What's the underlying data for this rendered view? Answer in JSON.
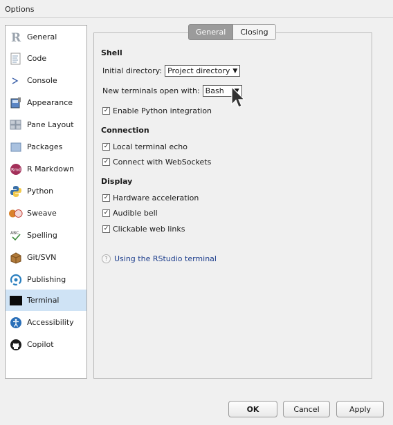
{
  "window": {
    "title": "Options"
  },
  "sidebar": {
    "items": [
      {
        "label": "General",
        "icon": "r-logo-icon"
      },
      {
        "label": "Code",
        "icon": "code-icon"
      },
      {
        "label": "Console",
        "icon": "console-icon"
      },
      {
        "label": "Appearance",
        "icon": "appearance-icon"
      },
      {
        "label": "Pane Layout",
        "icon": "pane-layout-icon"
      },
      {
        "label": "Packages",
        "icon": "packages-icon"
      },
      {
        "label": "R Markdown",
        "icon": "rmarkdown-icon"
      },
      {
        "label": "Python",
        "icon": "python-icon"
      },
      {
        "label": "Sweave",
        "icon": "sweave-icon"
      },
      {
        "label": "Spelling",
        "icon": "spelling-icon"
      },
      {
        "label": "Git/SVN",
        "icon": "git-icon"
      },
      {
        "label": "Publishing",
        "icon": "publishing-icon"
      },
      {
        "label": "Terminal",
        "icon": "terminal-icon"
      },
      {
        "label": "Accessibility",
        "icon": "accessibility-icon"
      },
      {
        "label": "Copilot",
        "icon": "github-icon"
      }
    ],
    "selected": "Terminal"
  },
  "tabs": [
    {
      "label": "General",
      "active": true
    },
    {
      "label": "Closing",
      "active": false
    }
  ],
  "shell": {
    "heading": "Shell",
    "initial_dir_label": "Initial directory:",
    "initial_dir_value": "Project directory",
    "new_terminal_label": "New terminals open with:",
    "new_terminal_value": "Bash",
    "python_label": "Enable Python integration",
    "python_checked": true
  },
  "connection": {
    "heading": "Connection",
    "echo_label": "Local terminal echo",
    "websockets_label": "Connect with WebSockets"
  },
  "display": {
    "heading": "Display",
    "hw_label": "Hardware acceleration",
    "bell_label": "Audible bell",
    "links_label": "Clickable web links"
  },
  "help": {
    "icon_text": "?",
    "link": "Using the RStudio terminal"
  },
  "buttons": {
    "ok": "OK",
    "cancel": "Cancel",
    "apply": "Apply"
  },
  "check_mark": "✓",
  "icon_text": {
    "rmarkdown": "Rmd",
    "spelling": "ABC"
  },
  "colors": {
    "selected_bg": "#cfe3f5",
    "link": "#1c3d8c",
    "active_tab": "#9b9b9b"
  }
}
